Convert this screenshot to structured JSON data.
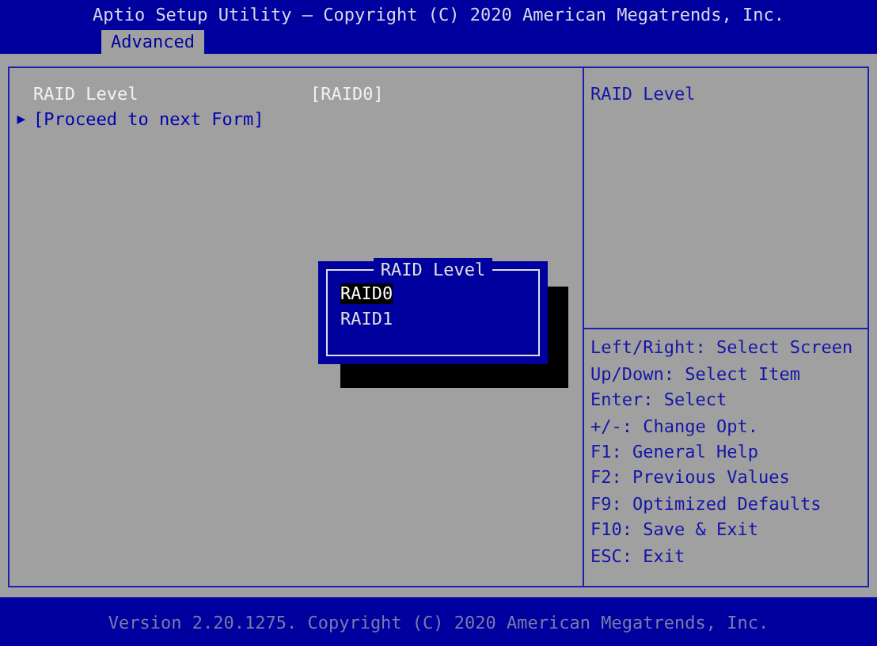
{
  "window": {
    "title": "Aptio Setup Utility – Copyright (C) 2020 American Megatrends, Inc."
  },
  "tabs": [
    {
      "label": "Advanced",
      "selected": true
    }
  ],
  "items": [
    {
      "kind": "setting",
      "label": "RAID Level",
      "value": "[RAID0]"
    },
    {
      "kind": "submenu",
      "label": "[Proceed to next Form]",
      "marker": "▶"
    }
  ],
  "help_text": "RAID Level",
  "key_help": [
    "Left/Right: Select Screen",
    "Up/Down: Select Item",
    "Enter: Select",
    "+/-: Change Opt.",
    "F1: General Help",
    "F2: Previous Values",
    "F9: Optimized Defaults",
    "F10: Save & Exit",
    "ESC: Exit"
  ],
  "popup": {
    "title": "RAID Level",
    "options": [
      {
        "label": "RAID0",
        "selected": true
      },
      {
        "label": "RAID1",
        "selected": false
      }
    ]
  },
  "status_bar": "Version 2.20.1275. Copyright (C) 2020 American Megatrends, Inc."
}
